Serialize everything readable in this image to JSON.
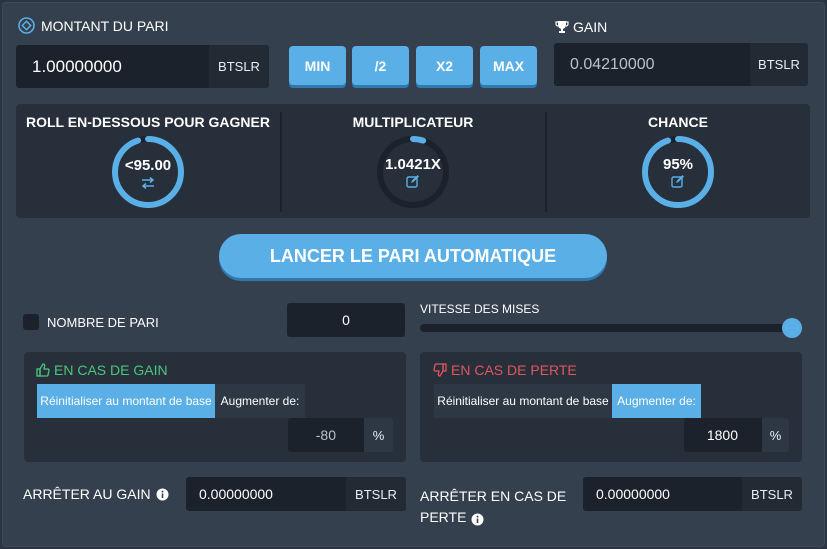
{
  "bet": {
    "label": "MONTANT DU PARI",
    "value": "1.00000000",
    "unit": "BTSLR"
  },
  "quick_buttons": [
    "MIN",
    "/2",
    "X2",
    "MAX"
  ],
  "gain": {
    "label": "GAIN",
    "value": "0.04210000",
    "unit": "BTSLR"
  },
  "stats": {
    "roll": {
      "title": "ROLL EN-DESSOUS POUR GAGNER",
      "value": "<95.00",
      "fill_fraction": 0.95
    },
    "multiplier": {
      "title": "MULTIPLICATEUR",
      "value": "1.0421X",
      "fill_fraction": 0.05
    },
    "chance": {
      "title": "CHANCE",
      "value": "95%",
      "fill_fraction": 0.95
    }
  },
  "launch_button": "LANCER LE PARI AUTOMATIQUE",
  "bet_count": {
    "label": "NOMBRE DE PARI",
    "value": "0"
  },
  "speed": {
    "label": "VITESSE DES MISES",
    "level": 1.0
  },
  "on_win": {
    "title": "EN CAS DE GAIN",
    "reset_label": "Réinitialiser au montant de base",
    "increase_label": "Augmenter de:",
    "active_tab": "reset",
    "value": "-80",
    "unit": "%"
  },
  "on_loss": {
    "title": "EN CAS DE PERTE",
    "reset_label": "Réinitialiser au montant de base",
    "increase_label": "Augmenter de:",
    "active_tab": "increase",
    "value": "1800",
    "unit": "%"
  },
  "stop_gain": {
    "label": "ARRÊTER AU GAIN",
    "value": "0.00000000",
    "unit": "BTSLR"
  },
  "stop_loss": {
    "label_line1": "ARRÊTER EN CAS DE",
    "label_line2": "PERTE",
    "value": "0.00000000",
    "unit": "BTSLR"
  },
  "colors": {
    "accent": "#5aafe6",
    "win": "#4cc77a",
    "loss": "#e2555e",
    "ring_track": "#1b222b"
  }
}
